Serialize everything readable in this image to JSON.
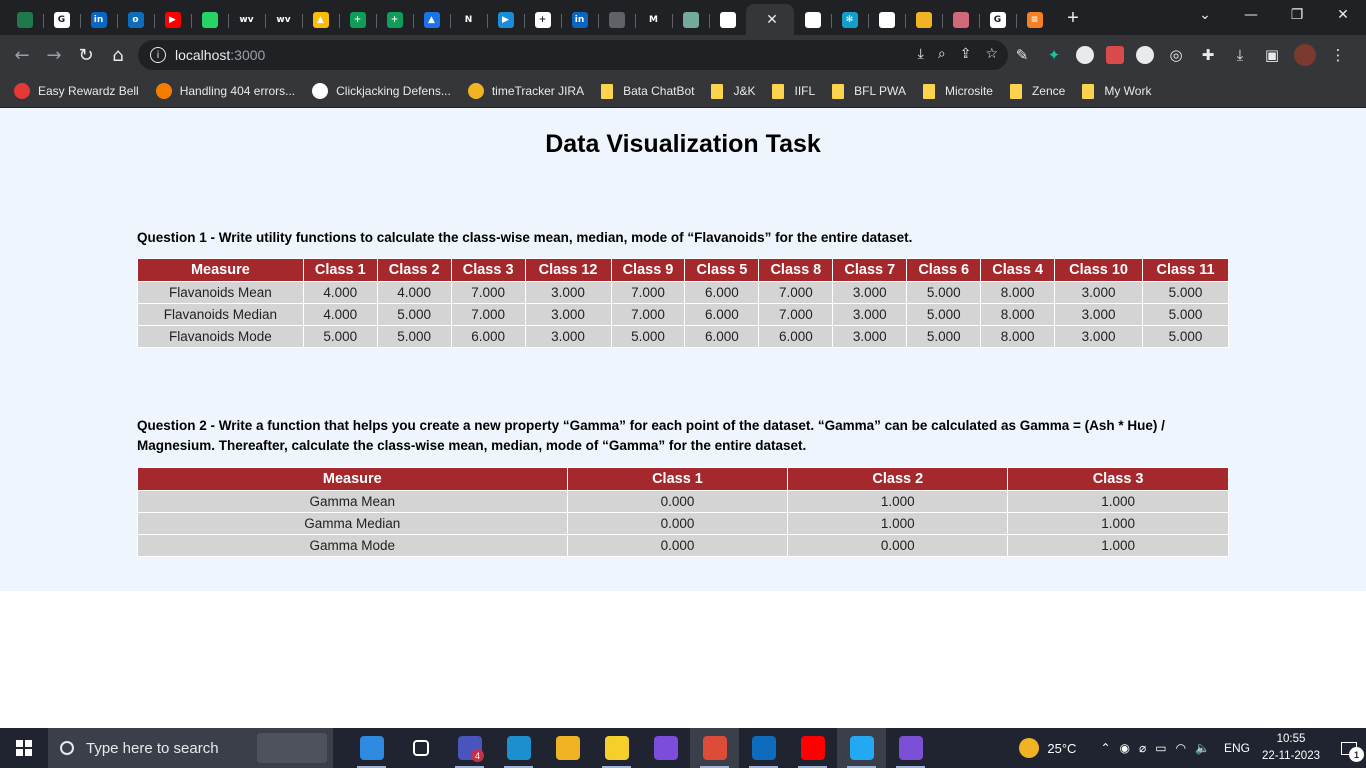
{
  "browser": {
    "tabs": [
      {
        "icon": "app-icon",
        "color": "#1e7a4a",
        "glyph": ""
      },
      {
        "icon": "google-icon",
        "color": "#ffffff",
        "glyph": "G"
      },
      {
        "icon": "linkedin-icon",
        "color": "#0a66c2",
        "glyph": "in"
      },
      {
        "icon": "outlook-icon",
        "color": "#0f6cbd",
        "glyph": "o"
      },
      {
        "icon": "youtube-icon",
        "color": "#ff0000",
        "glyph": "▶"
      },
      {
        "icon": "whatsapp-icon",
        "color": "#25d366",
        "glyph": ""
      },
      {
        "icon": "wv-icon",
        "color": "#202124",
        "glyph": "wv"
      },
      {
        "icon": "wv-icon",
        "color": "#202124",
        "glyph": "wv"
      },
      {
        "icon": "drive-icon",
        "color": "#fbbc04",
        "glyph": "▲"
      },
      {
        "icon": "sheets-icon",
        "color": "#0f9d58",
        "glyph": "+"
      },
      {
        "icon": "sheets-icon",
        "color": "#0f9d58",
        "glyph": "+"
      },
      {
        "icon": "drive-icon",
        "color": "#1a73e8",
        "glyph": "▲"
      },
      {
        "icon": "netflix-icon",
        "color": "#202124",
        "glyph": "N"
      },
      {
        "icon": "media-icon",
        "color": "#1a8cd8",
        "glyph": "▶"
      },
      {
        "icon": "app-icon",
        "color": "#ffffff",
        "glyph": "+"
      },
      {
        "icon": "linkedin-icon",
        "color": "#0a66c2",
        "glyph": "in"
      },
      {
        "icon": "app-icon",
        "color": "#5f6368",
        "glyph": ""
      },
      {
        "icon": "gmail-icon",
        "color": "#202124",
        "glyph": "M"
      },
      {
        "icon": "chatgpt-icon",
        "color": "#74aa9c",
        "glyph": ""
      },
      {
        "icon": "github-icon",
        "color": "#ffffff",
        "glyph": ""
      }
    ],
    "tabs_after": [
      {
        "icon": "github-icon",
        "color": "#ffffff",
        "glyph": ""
      },
      {
        "icon": "react-icon",
        "color": "#149eca",
        "glyph": "✻"
      },
      {
        "icon": "github-icon",
        "color": "#ffffff",
        "glyph": ""
      },
      {
        "icon": "chrome-icon",
        "color": "#f0b323",
        "glyph": ""
      },
      {
        "icon": "app-icon",
        "color": "#d2697a",
        "glyph": ""
      },
      {
        "icon": "google-icon",
        "color": "#ffffff",
        "glyph": "G"
      },
      {
        "icon": "stackoverflow-icon",
        "color": "#f48024",
        "glyph": "≡"
      }
    ],
    "url_host": "localhost",
    "url_port": ":3000",
    "bookmarks": [
      {
        "label": "Easy Rewardz Bell",
        "icon_color": "#e53935",
        "folder": false
      },
      {
        "label": "Handling 404 errors...",
        "icon_color": "#f57c00",
        "folder": false
      },
      {
        "label": "Clickjacking Defens...",
        "icon_color": "#ffffff",
        "folder": false
      },
      {
        "label": "timeTracker JIRA",
        "icon_color": "#f0b323",
        "folder": false
      },
      {
        "label": "Bata ChatBot",
        "icon_color": "#fbd34d",
        "folder": true
      },
      {
        "label": "J&K",
        "icon_color": "#fbd34d",
        "folder": true
      },
      {
        "label": "IIFL",
        "icon_color": "#fbd34d",
        "folder": true
      },
      {
        "label": "BFL PWA",
        "icon_color": "#fbd34d",
        "folder": true
      },
      {
        "label": "Microsite",
        "icon_color": "#fbd34d",
        "folder": true
      },
      {
        "label": "Zence",
        "icon_color": "#fbd34d",
        "folder": true
      },
      {
        "label": "My Work",
        "icon_color": "#fbd34d",
        "folder": true
      }
    ]
  },
  "page": {
    "title": "Data Visualization Task",
    "q1": {
      "text": "Question 1 - Write utility functions to calculate the class-wise mean, median, mode of “Flavanoids” for the entire dataset.",
      "headers": [
        "Measure",
        "Class 1",
        "Class 2",
        "Class 3",
        "Class 12",
        "Class 9",
        "Class 5",
        "Class 8",
        "Class 7",
        "Class 6",
        "Class 4",
        "Class 10",
        "Class 11"
      ],
      "rows": [
        [
          "Flavanoids Mean",
          "4.000",
          "4.000",
          "7.000",
          "3.000",
          "7.000",
          "6.000",
          "7.000",
          "3.000",
          "5.000",
          "8.000",
          "3.000",
          "5.000"
        ],
        [
          "Flavanoids Median",
          "4.000",
          "5.000",
          "7.000",
          "3.000",
          "7.000",
          "6.000",
          "7.000",
          "3.000",
          "5.000",
          "8.000",
          "3.000",
          "5.000"
        ],
        [
          "Flavanoids Mode",
          "5.000",
          "5.000",
          "6.000",
          "3.000",
          "5.000",
          "6.000",
          "6.000",
          "3.000",
          "5.000",
          "8.000",
          "3.000",
          "5.000"
        ]
      ]
    },
    "q2": {
      "text": "Question 2 - Write a function that helps you create a new property “Gamma” for each point of the dataset. “Gamma” can be calculated as Gamma = (Ash * Hue) / Magnesium. Thereafter, calculate the class-wise mean, median, mode of “Gamma” for the entire dataset.",
      "headers": [
        "Measure",
        "Class 1",
        "Class 2",
        "Class 3"
      ],
      "rows": [
        [
          "Gamma Mean",
          "0.000",
          "1.000",
          "1.000"
        ],
        [
          "Gamma Median",
          "0.000",
          "1.000",
          "1.000"
        ],
        [
          "Gamma Mode",
          "0.000",
          "0.000",
          "1.000"
        ]
      ]
    }
  },
  "taskbar": {
    "search_placeholder": "Type here to search",
    "teams_badge": "4",
    "temperature": "25°C",
    "language": "ENG",
    "time": "10:55",
    "date": "22-11-2023",
    "notification_count": "1",
    "apps": [
      {
        "name": "file-explorer-icon",
        "color": "#2d8ae0"
      },
      {
        "name": "task-view-icon",
        "color": "#1f2430"
      },
      {
        "name": "teams-icon",
        "color": "#4b53bc"
      },
      {
        "name": "edge-icon",
        "color": "#1d8fce"
      },
      {
        "name": "file-explorer-icon",
        "color": "#f0b323"
      },
      {
        "name": "sticky-notes-icon",
        "color": "#f5d02b"
      },
      {
        "name": "visual-studio-icon",
        "color": "#7c4ddb"
      },
      {
        "name": "chrome-icon",
        "color": "#dd4b39"
      },
      {
        "name": "outlook-icon",
        "color": "#0f6cbd"
      },
      {
        "name": "youtube-icon",
        "color": "#ff0000"
      },
      {
        "name": "vscode-icon",
        "color": "#23a9f2"
      },
      {
        "name": "github-desktop-icon",
        "color": "#7b4fd6"
      }
    ]
  }
}
